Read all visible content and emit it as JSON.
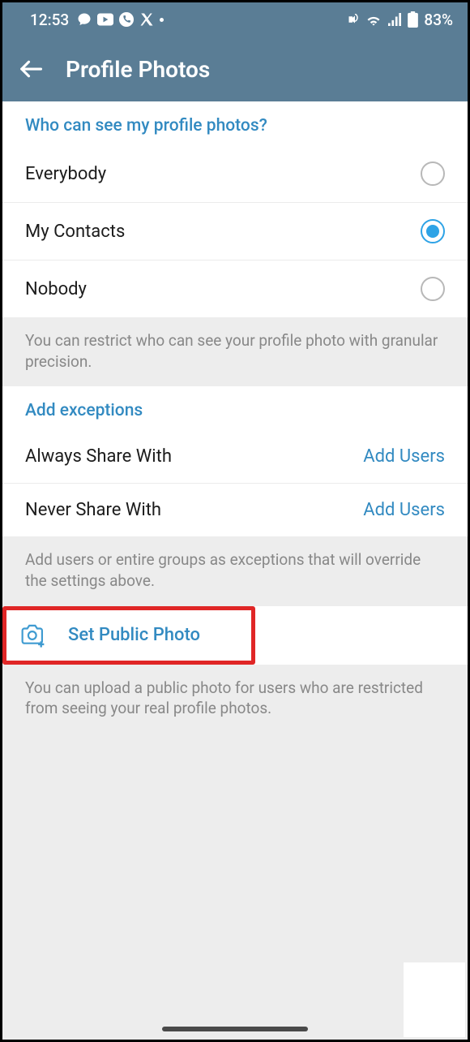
{
  "status": {
    "time": "12:53",
    "battery": "83%"
  },
  "header": {
    "title": "Profile Photos"
  },
  "visibility": {
    "title": "Who can see my profile photos?",
    "options": [
      {
        "label": "Everybody",
        "selected": false
      },
      {
        "label": "My Contacts",
        "selected": true
      },
      {
        "label": "Nobody",
        "selected": false
      }
    ],
    "footer": "You can restrict who can see your profile photo with granular precision."
  },
  "exceptions": {
    "title": "Add exceptions",
    "rows": [
      {
        "label": "Always Share With",
        "action": "Add Users"
      },
      {
        "label": "Never Share With",
        "action": "Add Users"
      }
    ],
    "footer": "Add users or entire groups as exceptions that will override the settings above."
  },
  "publicPhoto": {
    "label": "Set Public Photo",
    "footer": "You can upload a public photo for users who are restricted from seeing your real profile photos."
  }
}
